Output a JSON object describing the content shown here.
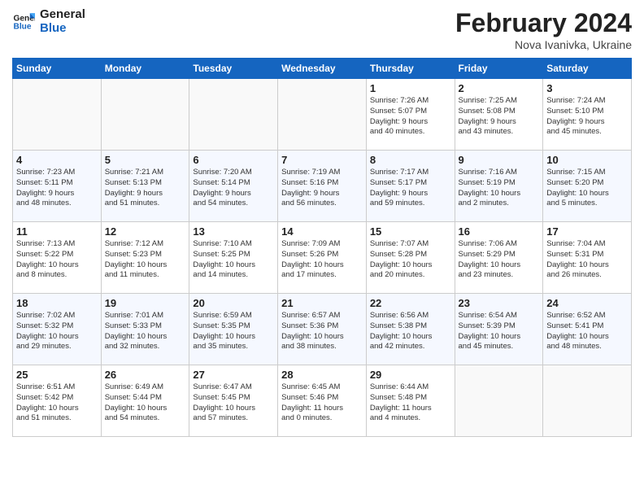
{
  "header": {
    "logo_line1": "General",
    "logo_line2": "Blue",
    "month_title": "February 2024",
    "subtitle": "Nova Ivanivka, Ukraine"
  },
  "weekdays": [
    "Sunday",
    "Monday",
    "Tuesday",
    "Wednesday",
    "Thursday",
    "Friday",
    "Saturday"
  ],
  "weeks": [
    [
      {
        "day": "",
        "info": ""
      },
      {
        "day": "",
        "info": ""
      },
      {
        "day": "",
        "info": ""
      },
      {
        "day": "",
        "info": ""
      },
      {
        "day": "1",
        "info": "Sunrise: 7:26 AM\nSunset: 5:07 PM\nDaylight: 9 hours\nand 40 minutes."
      },
      {
        "day": "2",
        "info": "Sunrise: 7:25 AM\nSunset: 5:08 PM\nDaylight: 9 hours\nand 43 minutes."
      },
      {
        "day": "3",
        "info": "Sunrise: 7:24 AM\nSunset: 5:10 PM\nDaylight: 9 hours\nand 45 minutes."
      }
    ],
    [
      {
        "day": "4",
        "info": "Sunrise: 7:23 AM\nSunset: 5:11 PM\nDaylight: 9 hours\nand 48 minutes."
      },
      {
        "day": "5",
        "info": "Sunrise: 7:21 AM\nSunset: 5:13 PM\nDaylight: 9 hours\nand 51 minutes."
      },
      {
        "day": "6",
        "info": "Sunrise: 7:20 AM\nSunset: 5:14 PM\nDaylight: 9 hours\nand 54 minutes."
      },
      {
        "day": "7",
        "info": "Sunrise: 7:19 AM\nSunset: 5:16 PM\nDaylight: 9 hours\nand 56 minutes."
      },
      {
        "day": "8",
        "info": "Sunrise: 7:17 AM\nSunset: 5:17 PM\nDaylight: 9 hours\nand 59 minutes."
      },
      {
        "day": "9",
        "info": "Sunrise: 7:16 AM\nSunset: 5:19 PM\nDaylight: 10 hours\nand 2 minutes."
      },
      {
        "day": "10",
        "info": "Sunrise: 7:15 AM\nSunset: 5:20 PM\nDaylight: 10 hours\nand 5 minutes."
      }
    ],
    [
      {
        "day": "11",
        "info": "Sunrise: 7:13 AM\nSunset: 5:22 PM\nDaylight: 10 hours\nand 8 minutes."
      },
      {
        "day": "12",
        "info": "Sunrise: 7:12 AM\nSunset: 5:23 PM\nDaylight: 10 hours\nand 11 minutes."
      },
      {
        "day": "13",
        "info": "Sunrise: 7:10 AM\nSunset: 5:25 PM\nDaylight: 10 hours\nand 14 minutes."
      },
      {
        "day": "14",
        "info": "Sunrise: 7:09 AM\nSunset: 5:26 PM\nDaylight: 10 hours\nand 17 minutes."
      },
      {
        "day": "15",
        "info": "Sunrise: 7:07 AM\nSunset: 5:28 PM\nDaylight: 10 hours\nand 20 minutes."
      },
      {
        "day": "16",
        "info": "Sunrise: 7:06 AM\nSunset: 5:29 PM\nDaylight: 10 hours\nand 23 minutes."
      },
      {
        "day": "17",
        "info": "Sunrise: 7:04 AM\nSunset: 5:31 PM\nDaylight: 10 hours\nand 26 minutes."
      }
    ],
    [
      {
        "day": "18",
        "info": "Sunrise: 7:02 AM\nSunset: 5:32 PM\nDaylight: 10 hours\nand 29 minutes."
      },
      {
        "day": "19",
        "info": "Sunrise: 7:01 AM\nSunset: 5:33 PM\nDaylight: 10 hours\nand 32 minutes."
      },
      {
        "day": "20",
        "info": "Sunrise: 6:59 AM\nSunset: 5:35 PM\nDaylight: 10 hours\nand 35 minutes."
      },
      {
        "day": "21",
        "info": "Sunrise: 6:57 AM\nSunset: 5:36 PM\nDaylight: 10 hours\nand 38 minutes."
      },
      {
        "day": "22",
        "info": "Sunrise: 6:56 AM\nSunset: 5:38 PM\nDaylight: 10 hours\nand 42 minutes."
      },
      {
        "day": "23",
        "info": "Sunrise: 6:54 AM\nSunset: 5:39 PM\nDaylight: 10 hours\nand 45 minutes."
      },
      {
        "day": "24",
        "info": "Sunrise: 6:52 AM\nSunset: 5:41 PM\nDaylight: 10 hours\nand 48 minutes."
      }
    ],
    [
      {
        "day": "25",
        "info": "Sunrise: 6:51 AM\nSunset: 5:42 PM\nDaylight: 10 hours\nand 51 minutes."
      },
      {
        "day": "26",
        "info": "Sunrise: 6:49 AM\nSunset: 5:44 PM\nDaylight: 10 hours\nand 54 minutes."
      },
      {
        "day": "27",
        "info": "Sunrise: 6:47 AM\nSunset: 5:45 PM\nDaylight: 10 hours\nand 57 minutes."
      },
      {
        "day": "28",
        "info": "Sunrise: 6:45 AM\nSunset: 5:46 PM\nDaylight: 11 hours\nand 0 minutes."
      },
      {
        "day": "29",
        "info": "Sunrise: 6:44 AM\nSunset: 5:48 PM\nDaylight: 11 hours\nand 4 minutes."
      },
      {
        "day": "",
        "info": ""
      },
      {
        "day": "",
        "info": ""
      }
    ]
  ]
}
